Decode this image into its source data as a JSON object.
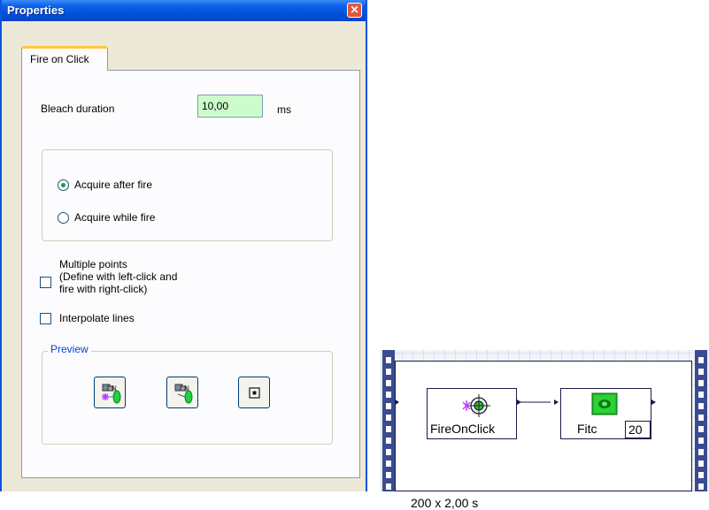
{
  "window": {
    "title": "Properties",
    "close_glyph": "✕"
  },
  "tab": {
    "label": "Fire on Click"
  },
  "bleach": {
    "label": "Bleach duration",
    "value": "10,00",
    "unit": "ms"
  },
  "acquire": {
    "options": [
      {
        "label": "Acquire after fire",
        "selected": true
      },
      {
        "label": "Acquire while fire",
        "selected": false
      }
    ]
  },
  "multiple_points": {
    "label_line1": "Multiple points",
    "label_line2": "(Define with left-click and",
    "label_line3": "fire with right-click)",
    "checked": false
  },
  "interpolate": {
    "label": "Interpolate lines",
    "checked": false
  },
  "preview": {
    "legend": "Preview",
    "buttons": [
      "preview-fire-acquire-icon",
      "preview-fire-icon",
      "stop-square-icon"
    ]
  },
  "workflow": {
    "node1_label": "FireOnClick",
    "node2_label": "Fitc",
    "node2_count": "20",
    "loop_label": "200 x 2,00 s"
  },
  "colors": {
    "titlebar": "#0a5fe8",
    "input_bg": "#ccfccc",
    "legend_text": "#0046d5",
    "film": "#3a4b8f",
    "fitc_green": "#1fb82a"
  }
}
